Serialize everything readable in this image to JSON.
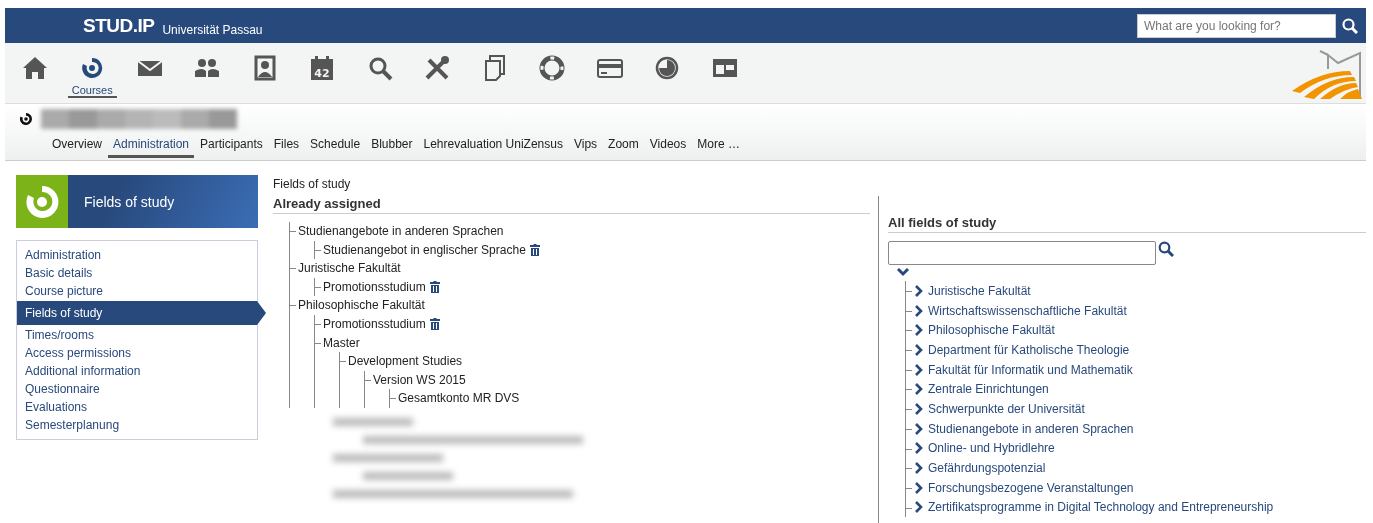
{
  "brand": {
    "logo": "STUD.IP",
    "university": "Universität Passau"
  },
  "search": {
    "placeholder": "What are you looking for?"
  },
  "nav_icons": [
    {
      "kind": "home",
      "selected": false
    },
    {
      "kind": "courses",
      "label": "Courses",
      "selected": true
    },
    {
      "kind": "mail",
      "selected": false
    },
    {
      "kind": "people",
      "selected": false
    },
    {
      "kind": "profile",
      "selected": false
    },
    {
      "kind": "calendar",
      "day": "42",
      "selected": false
    },
    {
      "kind": "search",
      "selected": false
    },
    {
      "kind": "tools",
      "selected": false
    },
    {
      "kind": "files",
      "selected": false
    },
    {
      "kind": "help",
      "selected": false
    },
    {
      "kind": "card",
      "selected": false
    },
    {
      "kind": "pie",
      "selected": false
    },
    {
      "kind": "dashboard",
      "selected": false
    }
  ],
  "course_tabs": [
    {
      "label": "Overview",
      "selected": false
    },
    {
      "label": "Administration",
      "selected": true
    },
    {
      "label": "Participants",
      "selected": false
    },
    {
      "label": "Files",
      "selected": false
    },
    {
      "label": "Schedule",
      "selected": false
    },
    {
      "label": "Blubber",
      "selected": false
    },
    {
      "label": "Lehrevaluation UniZensus",
      "selected": false
    },
    {
      "label": "Vips",
      "selected": false
    },
    {
      "label": "Zoom",
      "selected": false
    },
    {
      "label": "Videos",
      "selected": false
    },
    {
      "label": "More …",
      "selected": false
    }
  ],
  "sidebar": {
    "title": "Fields of study",
    "items": [
      {
        "label": "Administration",
        "selected": false
      },
      {
        "label": "Basic details",
        "selected": false
      },
      {
        "label": "Course picture",
        "selected": false
      },
      {
        "label": "Fields of study",
        "selected": true
      },
      {
        "label": "Times/rooms",
        "selected": false
      },
      {
        "label": "Access permissions",
        "selected": false
      },
      {
        "label": "Additional information",
        "selected": false
      },
      {
        "label": "Questionnaire",
        "selected": false
      },
      {
        "label": "Evaluations",
        "selected": false
      },
      {
        "label": "Semesterplanung",
        "selected": false
      }
    ]
  },
  "page_title": "Fields of study",
  "assigned": {
    "heading": "Already assigned",
    "tree": [
      {
        "label": "Studienangebote in anderen Sprachen",
        "removable": false,
        "children": [
          {
            "label": "Studienangebot in englischer Sprache",
            "removable": true
          }
        ]
      },
      {
        "label": "Juristische Fakultät",
        "removable": false,
        "children": [
          {
            "label": "Promotionsstudium",
            "removable": true
          }
        ]
      },
      {
        "label": "Philosophische Fakultät",
        "removable": false,
        "children": [
          {
            "label": "Promotionsstudium",
            "removable": true
          },
          {
            "label": "Master",
            "removable": false,
            "children": [
              {
                "label": "Development Studies",
                "removable": false,
                "children": [
                  {
                    "label": "Version WS 2015",
                    "removable": false,
                    "children": [
                      {
                        "label": "Gesamtkonto MR DVS",
                        "removable": false
                      }
                    ]
                  }
                ]
              }
            ]
          }
        ]
      }
    ]
  },
  "all_fields": {
    "heading": "All fields of study",
    "root_expanded": true,
    "items": [
      {
        "label": "Juristische Fakultät",
        "expanded": false
      },
      {
        "label": "Wirtschaftswissenschaftliche Fakultät",
        "expanded": false
      },
      {
        "label": "Philosophische Fakultät",
        "expanded": false
      },
      {
        "label": "Department für Katholische Theologie",
        "expanded": false
      },
      {
        "label": "Fakultät für Informatik und Mathematik",
        "expanded": false
      },
      {
        "label": "Zentrale Einrichtungen",
        "expanded": false
      },
      {
        "label": "Schwerpunkte der Universität",
        "expanded": false
      },
      {
        "label": "Studienangebote in anderen Sprachen",
        "expanded": false
      },
      {
        "label": "Online- und Hybridlehre",
        "expanded": false
      },
      {
        "label": "Gefährdungspotenzial",
        "expanded": false
      },
      {
        "label": "Forschungsbezogene Veranstaltungen",
        "expanded": false
      },
      {
        "label": "Zertifikatsprogramme in Digital Technology and Entrepreneurship",
        "expanded": false
      }
    ]
  }
}
